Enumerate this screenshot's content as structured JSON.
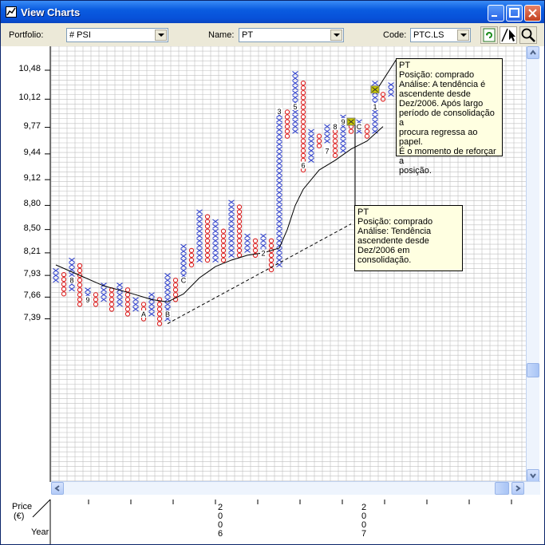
{
  "window": {
    "title": "View Charts"
  },
  "toolbar": {
    "portfolio_label": "Portfolio:",
    "portfolio_value": "# PSI",
    "name_label": "Name:",
    "name_value": "PT",
    "code_label": "Code:",
    "code_value": "PTC.LS"
  },
  "axes": {
    "price_label": "Price",
    "price_unit": "(€)",
    "year_label": "Year",
    "y_ticks": [
      "10,48",
      "10,12",
      "9,77",
      "9,44",
      "9,12",
      "8,80",
      "8,50",
      "8,21",
      "7,93",
      "7,66",
      "7,39"
    ],
    "year_marks": [
      {
        "digits": [
          "2",
          "0",
          "0",
          "6"
        ]
      },
      {
        "digits": [
          "2",
          "0",
          "0",
          "7"
        ]
      }
    ]
  },
  "callouts": [
    {
      "lines": [
        "PT",
        "Posição: comprado",
        "Análise: A tendência é",
        "ascendente desde",
        "Dez/2006. Após largo",
        "período de consolidação a",
        "procura regressa ao papel.",
        "É o momento de reforçar a",
        "posição."
      ]
    },
    {
      "lines": [
        "PT",
        "Posição: comprado",
        "Análise: Tendência",
        "ascendente desde",
        "Dez/2006 em",
        "consolidação."
      ]
    }
  ],
  "chart_data": {
    "type": "point-and-figure",
    "colors": {
      "x": "#3344CC",
      "o": "#DD2222",
      "grid": "#BFBFBF",
      "signal": "#C8C800"
    },
    "y_ticks": [
      10.48,
      10.12,
      9.77,
      9.44,
      9.12,
      8.8,
      8.5,
      8.21,
      7.93,
      7.66,
      7.39
    ],
    "columns": [
      {
        "type": "X",
        "from": 7.87,
        "to": 8.0
      },
      {
        "type": "O",
        "from": 7.7,
        "to": 7.93
      },
      {
        "type": "X",
        "from": 7.76,
        "to": 8.12
      },
      {
        "type": "O",
        "from": 7.57,
        "to": 8.06
      },
      {
        "type": "X",
        "from": 7.63,
        "to": 7.76
      },
      {
        "type": "O",
        "from": 7.57,
        "to": 7.7
      },
      {
        "type": "X",
        "from": 7.63,
        "to": 7.82
      },
      {
        "type": "O",
        "from": 7.51,
        "to": 7.76
      },
      {
        "type": "X",
        "from": 7.57,
        "to": 7.82
      },
      {
        "type": "O",
        "from": 7.45,
        "to": 7.76
      },
      {
        "type": "X",
        "from": 7.51,
        "to": 7.63
      },
      {
        "type": "O",
        "from": 7.39,
        "to": 7.57
      },
      {
        "type": "X",
        "from": 7.45,
        "to": 7.7
      },
      {
        "type": "O",
        "from": 7.33,
        "to": 7.63
      },
      {
        "type": "X",
        "from": 7.39,
        "to": 7.93
      },
      {
        "type": "O",
        "from": 7.63,
        "to": 7.87
      },
      {
        "type": "X",
        "from": 7.93,
        "to": 8.27
      },
      {
        "type": "O",
        "from": 8.06,
        "to": 8.21
      },
      {
        "type": "X",
        "from": 8.12,
        "to": 8.69
      },
      {
        "type": "O",
        "from": 8.12,
        "to": 8.63
      },
      {
        "type": "X",
        "from": 8.12,
        "to": 8.57
      },
      {
        "type": "O",
        "from": 8.12,
        "to": 8.5
      },
      {
        "type": "X",
        "from": 8.18,
        "to": 8.87
      },
      {
        "type": "O",
        "from": 8.18,
        "to": 8.75
      },
      {
        "type": "X",
        "from": 8.24,
        "to": 8.39
      },
      {
        "type": "O",
        "from": 8.18,
        "to": 8.33
      },
      {
        "type": "X",
        "from": 8.24,
        "to": 8.39
      },
      {
        "type": "O",
        "from": 8.0,
        "to": 8.33
      },
      {
        "type": "X",
        "from": 8.06,
        "to": 10.0
      },
      {
        "type": "O",
        "from": 9.66,
        "to": 9.94
      },
      {
        "type": "X",
        "from": 9.72,
        "to": 10.42
      },
      {
        "type": "O",
        "from": 9.24,
        "to": 10.3
      },
      {
        "type": "X",
        "from": 9.36,
        "to": 9.72
      },
      {
        "type": "O",
        "from": 9.54,
        "to": 9.66
      },
      {
        "type": "X",
        "from": 9.6,
        "to": 9.78
      },
      {
        "type": "O",
        "from": 9.42,
        "to": 9.72
      },
      {
        "type": "X",
        "from": 9.48,
        "to": 9.9
      },
      {
        "type": "O",
        "from": 9.72,
        "to": 9.78
      },
      {
        "type": "X",
        "from": 9.72,
        "to": 9.84
      },
      {
        "type": "O",
        "from": 9.66,
        "to": 9.78
      },
      {
        "type": "X",
        "from": 9.72,
        "to": 10.3
      },
      {
        "type": "O",
        "from": 10.12,
        "to": 10.18
      },
      {
        "type": "X",
        "from": 10.18,
        "to": 10.3
      }
    ],
    "markers": [
      {
        "label": "8",
        "col": 2,
        "price": 7.87
      },
      {
        "label": "9",
        "col": 4,
        "price": 7.63
      },
      {
        "label": "A",
        "col": 11,
        "price": 7.45
      },
      {
        "label": "B",
        "col": 14,
        "price": 7.45
      },
      {
        "label": "C",
        "col": 16,
        "price": 7.87
      },
      {
        "label": "2",
        "col": 26,
        "price": 8.21
      },
      {
        "label": "3",
        "col": 28,
        "price": 9.97
      },
      {
        "label": "5",
        "col": 30,
        "price": 10.03
      },
      {
        "label": "6",
        "col": 31,
        "price": 9.3
      },
      {
        "label": "7",
        "col": 34,
        "price": 9.48
      },
      {
        "label": "8",
        "col": 35,
        "price": 9.78
      },
      {
        "label": "9",
        "col": 36,
        "price": 9.84
      },
      {
        "label": "C",
        "col": 38,
        "price": 9.78
      },
      {
        "label": "1",
        "col": 40,
        "price": 10.03
      }
    ],
    "signals": [
      {
        "col": 37,
        "price": 9.84
      },
      {
        "col": 40,
        "price": 10.24
      }
    ],
    "moving_average": [
      [
        0,
        8.06
      ],
      [
        3,
        7.93
      ],
      [
        6,
        7.8
      ],
      [
        9,
        7.72
      ],
      [
        12,
        7.63
      ],
      [
        14,
        7.6
      ],
      [
        16,
        7.7
      ],
      [
        18,
        7.9
      ],
      [
        20,
        8.04
      ],
      [
        22,
        8.12
      ],
      [
        24,
        8.18
      ],
      [
        26,
        8.21
      ],
      [
        28,
        8.27
      ],
      [
        29,
        8.5
      ],
      [
        30,
        8.8
      ],
      [
        31,
        9.0
      ],
      [
        33,
        9.24
      ],
      [
        35,
        9.36
      ],
      [
        37,
        9.5
      ],
      [
        39,
        9.6
      ],
      [
        41,
        9.78
      ]
    ],
    "trendline": [
      [
        14,
        7.33
      ],
      [
        37,
        8.57
      ]
    ]
  }
}
